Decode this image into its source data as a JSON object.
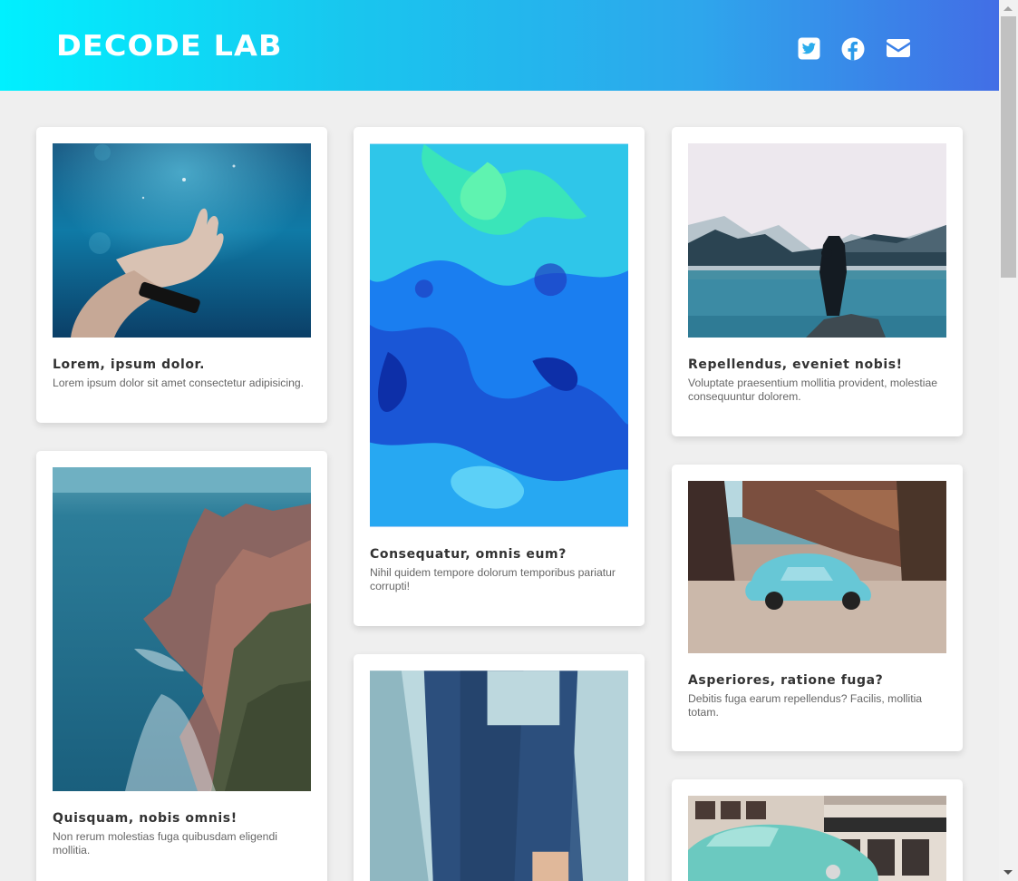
{
  "header": {
    "logo": "DECODE LAB",
    "social": [
      {
        "name": "twitter-icon"
      },
      {
        "name": "facebook-icon"
      },
      {
        "name": "envelope-icon"
      }
    ],
    "gradient_colors": [
      "#00f0ff",
      "#426ee6"
    ]
  },
  "cards": [
    {
      "title": "Lorem, ipsum dolor.",
      "text": "Lorem ipsum dolor sit amet consectetur adipisicing.",
      "image": "underwater-hand-image"
    },
    {
      "title": "Quisquam, nobis omnis!",
      "text": "Non rerum molestias fuga quibusdam eligendi mollitia.",
      "image": "coastal-cliffs-image"
    },
    {
      "title": "Consequatur, omnis eum?",
      "text": "Nihil quidem tempore dolorum temporibus pariatur corrupti!",
      "image": "blue-abstract-paint-image"
    },
    {
      "title": "",
      "text": "",
      "image": "person-denim-shirt-image"
    },
    {
      "title": "Repellendus, eveniet nobis!",
      "text": "Voluptate praesentium mollitia provident, molestiae consequuntur dolorem.",
      "image": "lake-mountains-person-image"
    },
    {
      "title": "Asperiores, ratione fuga?",
      "text": "Debitis fuga earum repellendus? Facilis, mollitia totam.",
      "image": "vintage-beetle-car-image"
    },
    {
      "title": "",
      "text": "",
      "image": "classic-car-street-image"
    }
  ]
}
